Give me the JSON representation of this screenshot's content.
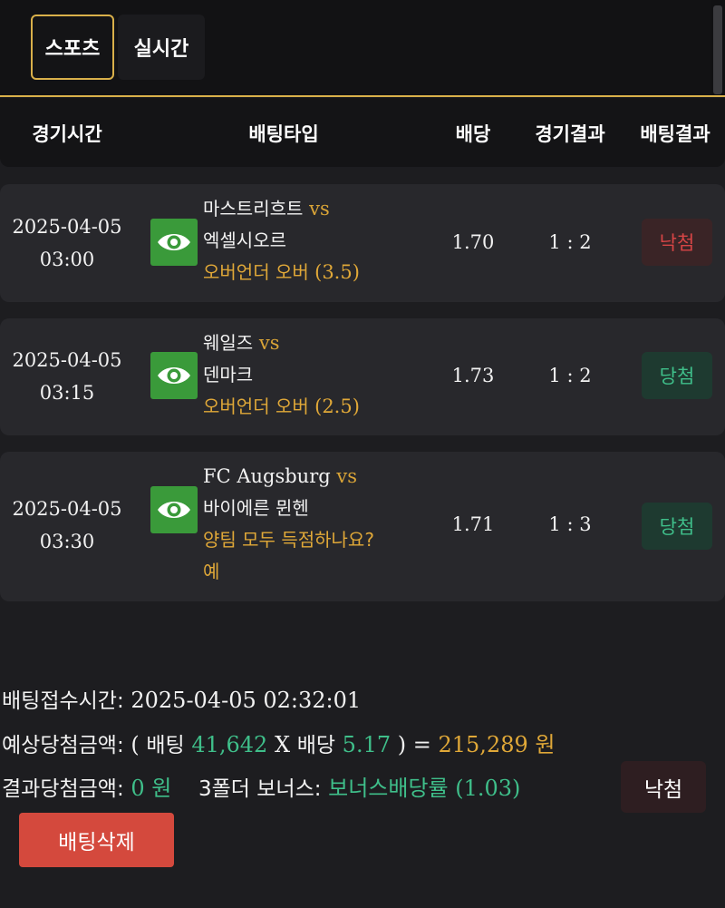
{
  "tabs": [
    {
      "label": "스포츠"
    },
    {
      "label": "실시간"
    }
  ],
  "columns": [
    "경기시간",
    "배팅타입",
    "배당",
    "경기결과",
    "배팅결과"
  ],
  "rows": [
    {
      "date": "2025-04-05",
      "time": "03:00",
      "home": "마스트리흐트",
      "vs": "vs",
      "away": "엑셀시오르",
      "bet_type": "오버언더 오버",
      "bet_line": "(3.5)",
      "odds": "1.70",
      "score": "1 : 2",
      "result": "낙첨"
    },
    {
      "date": "2025-04-05",
      "time": "03:15",
      "home": "웨일즈",
      "vs": "vs",
      "away": "덴마크",
      "bet_type": "오버언더 오버",
      "bet_line": "(2.5)",
      "odds": "1.73",
      "score": "1 : 2",
      "result": "당첨"
    },
    {
      "date": "2025-04-05",
      "time": "03:30",
      "home": "FC Augsburg",
      "vs": "vs",
      "away": "바이에른 뮌헨",
      "bet_type": "양팀 모두 득점하나요?",
      "bet_pick": "예",
      "odds": "1.71",
      "score": "1 : 3",
      "result": "당첨"
    }
  ],
  "summary": {
    "received_label": "배팅접수시간:",
    "received_value": "2025-04-05 02:32:01",
    "expected_label": "예상당첨금액:",
    "open_paren": "(",
    "bet_label": "배팅",
    "bet_amount": "41,642",
    "times": "X",
    "odds_label": "배당",
    "total_odds": "5.17",
    "close_paren_eq": ") =",
    "expected_amount": "215,289 원",
    "result_label": "결과당첨금액:",
    "result_amount": "0 원",
    "bonus_label": "3폴더 보너스:",
    "bonus_value": "보너스배당률 (1.03)"
  },
  "buttons": {
    "result": "낙첨",
    "delete": "배팅삭제"
  },
  "icons": {
    "view": "eye-icon"
  },
  "colors": {
    "accent": "#d9b04a",
    "win": "#3fbf8a",
    "lose": "#d64545",
    "view_button": "#3a9a3a",
    "delete_button": "#d4493d"
  }
}
